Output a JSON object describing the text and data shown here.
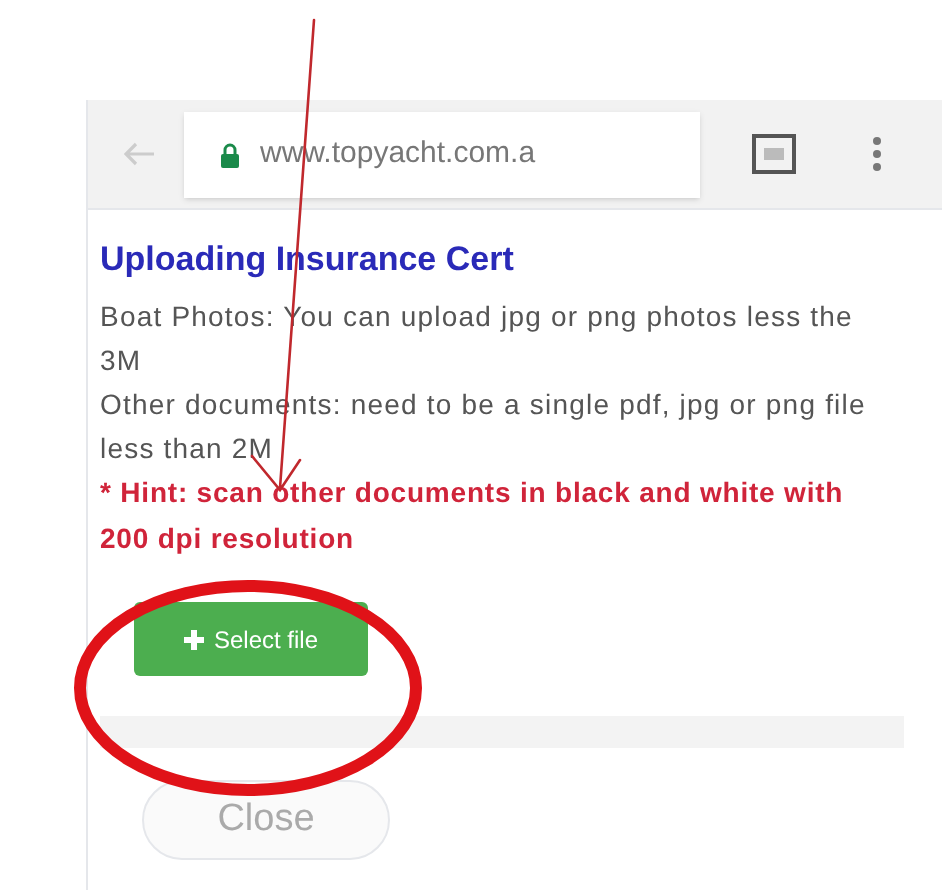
{
  "browser": {
    "url": "www.topyacht.com.a"
  },
  "page": {
    "title": "Uploading Insurance Cert",
    "paragraphs": [
      "Boat Photos: You can upload jpg or png photos less the 3M",
      "Other documents: need to be a single pdf, jpg or png file less than 2M"
    ],
    "hint": "* Hint: scan other documents in black and white with 200 dpi resolution",
    "select_button": "Select file",
    "upload_progress": {
      "level": 0
    },
    "close_button": "Close"
  }
}
